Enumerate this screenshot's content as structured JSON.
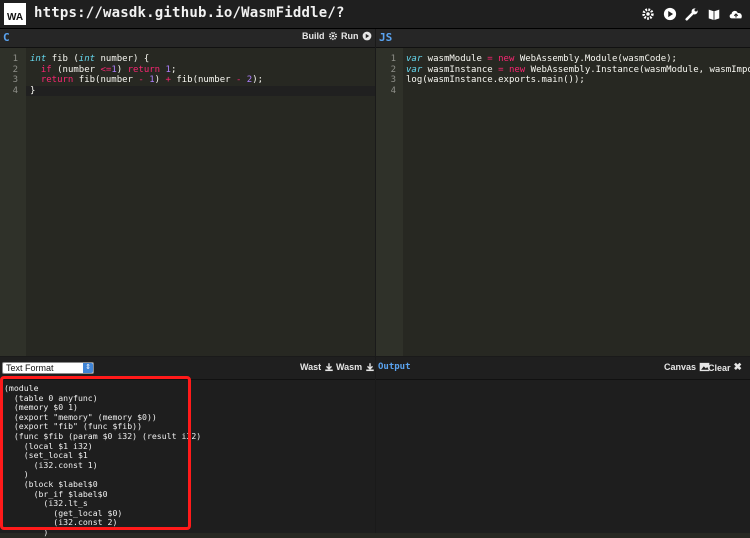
{
  "topbar": {
    "logo_text": "WA",
    "url": "https://wasdk.github.io/WasmFiddle/?",
    "icons": [
      "gear-icon",
      "play-icon",
      "wrench-icon",
      "book-icon",
      "cloud-upload-icon"
    ]
  },
  "c_pane": {
    "label": "C",
    "build_label": "Build",
    "run_label": "Run",
    "line_numbers": [
      "1",
      "2",
      "3",
      "4"
    ],
    "lines": [
      "int fib (int number) {",
      "  if (number <=1) return 1;",
      "  return fib(number - 1) + fib(number - 2);",
      "}"
    ]
  },
  "js_pane": {
    "label": "JS",
    "line_numbers": [
      "1",
      "2",
      "3",
      "4"
    ],
    "lines": [
      "var wasmModule = new WebAssembly.Module(wasmCode);",
      "var wasmInstance = new WebAssembly.Instance(wasmModule, wasmImports);",
      "log(wasmInstance.exports.main());",
      ""
    ]
  },
  "bottom_left": {
    "format_select": "Text Format",
    "wast_label": "Wast",
    "wasm_label": "Wasm",
    "wast_lines": [
      "(module",
      "  (table 0 anyfunc)",
      "  (memory $0 1)",
      "  (export \"memory\" (memory $0))",
      "  (export \"fib\" (func $fib))",
      "  (func $fib (param $0 i32) (result i32)",
      "    (local $1 i32)",
      "    (set_local $1",
      "      (i32.const 1)",
      "    )",
      "    (block $label$0",
      "      (br_if $label$0",
      "        (i32.lt_s",
      "          (get_local $0)",
      "          (i32.const 2)",
      "        )"
    ]
  },
  "bottom_right": {
    "output_label": "Output",
    "canvas_label": "Canvas",
    "clear_label": "Clear"
  },
  "colors": {
    "accent": "#5aa3f0",
    "highlight": "#ff1a1a",
    "editor_bg": "#272822"
  }
}
